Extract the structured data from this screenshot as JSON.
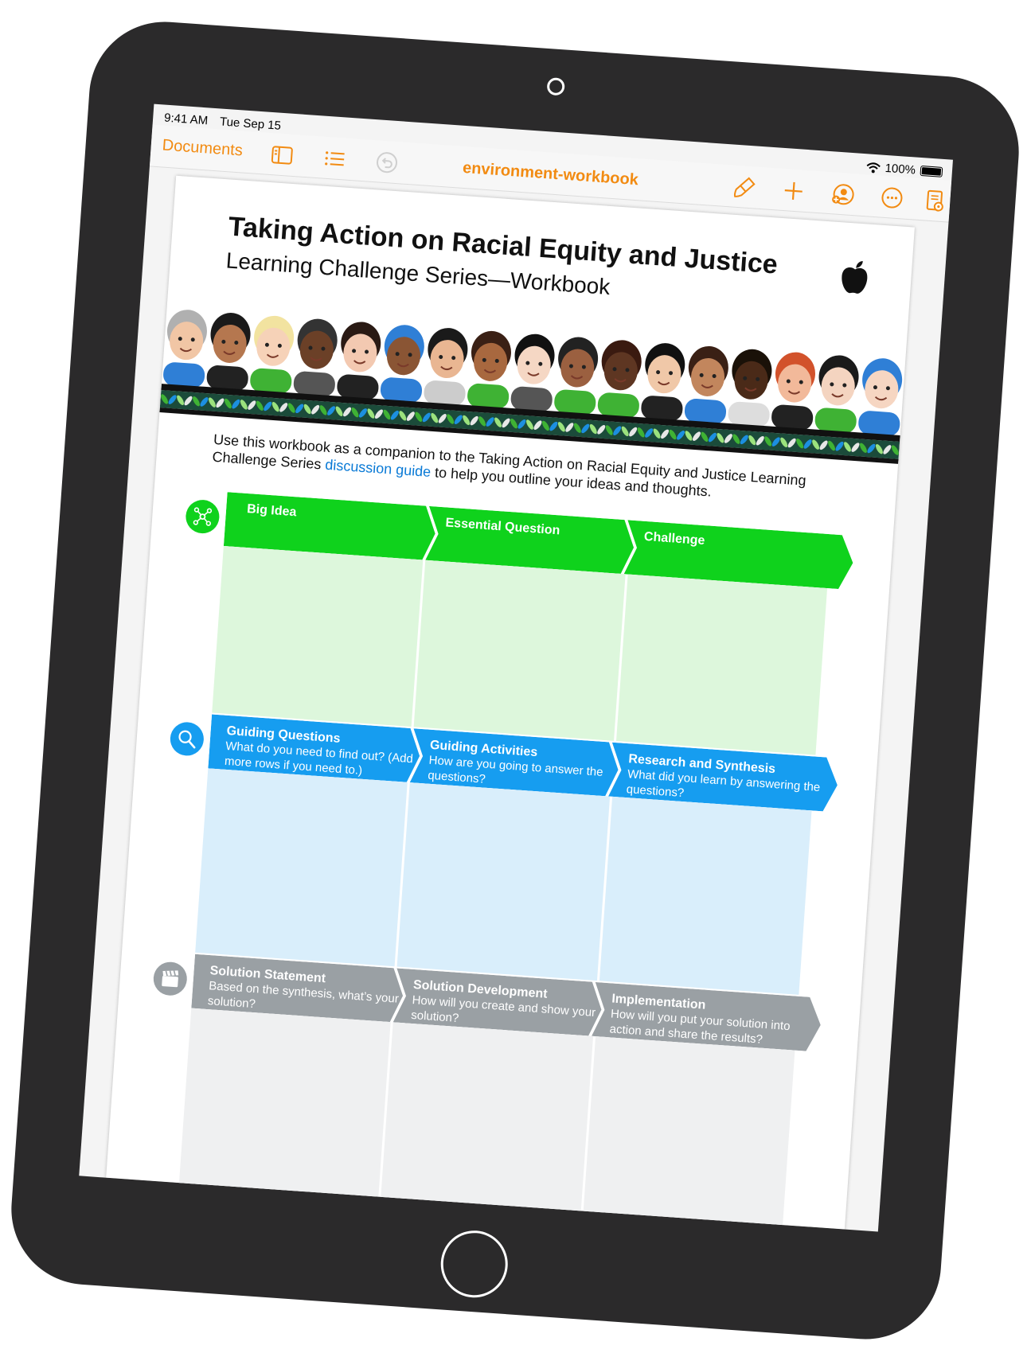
{
  "status": {
    "time": "9:41 AM",
    "date": "Tue Sep 15",
    "battery": "100%"
  },
  "toolbar": {
    "documents_label": "Documents",
    "doc_title": "environment-workbook",
    "accent_color": "#f28b12",
    "icons": [
      "sidebar-icon",
      "list-icon",
      "undo-icon",
      "paintbrush-icon",
      "plus-icon",
      "collaborate-icon",
      "more-icon",
      "reader-icon"
    ]
  },
  "doc": {
    "title": "Taking Action on Racial Equity and Justice",
    "subtitle": "Learning Challenge Series—Workbook",
    "intro_before": "Use this workbook as a companion to the Taking Action on Racial Equity and Justice Learning Challenge Series ",
    "intro_link": "discussion guide",
    "intro_after": " to help you outline your ideas and thoughts."
  },
  "rows": [
    {
      "color": "#0fd21c",
      "fill": "#ddf7dc",
      "icon": "network-icon",
      "cols": [
        {
          "heading": "Big Idea",
          "question": ""
        },
        {
          "heading": "Essential Question",
          "question": ""
        },
        {
          "heading": "Challenge",
          "question": ""
        }
      ]
    },
    {
      "color": "#169df0",
      "fill": "#d9eefb",
      "icon": "magnifier-icon",
      "cols": [
        {
          "heading": "Guiding Questions",
          "question": "What do you need to find out? (Add more rows if you need to.)"
        },
        {
          "heading": "Guiding Activities",
          "question": "How are you going to answer the questions?"
        },
        {
          "heading": "Research and Synthesis",
          "question": "What did you learn by answering the questions?"
        }
      ]
    },
    {
      "color": "#9aa0a4",
      "fill": "#eff0f1",
      "icon": "clapperboard-icon",
      "cols": [
        {
          "heading": "Solution Statement",
          "question": "Based on the synthesis, what’s your solution?"
        },
        {
          "heading": "Solution Development",
          "question": "How will you create and show your solution?"
        },
        {
          "heading": "Implementation",
          "question": "How will you put your solution into action and share the results?"
        }
      ]
    }
  ]
}
